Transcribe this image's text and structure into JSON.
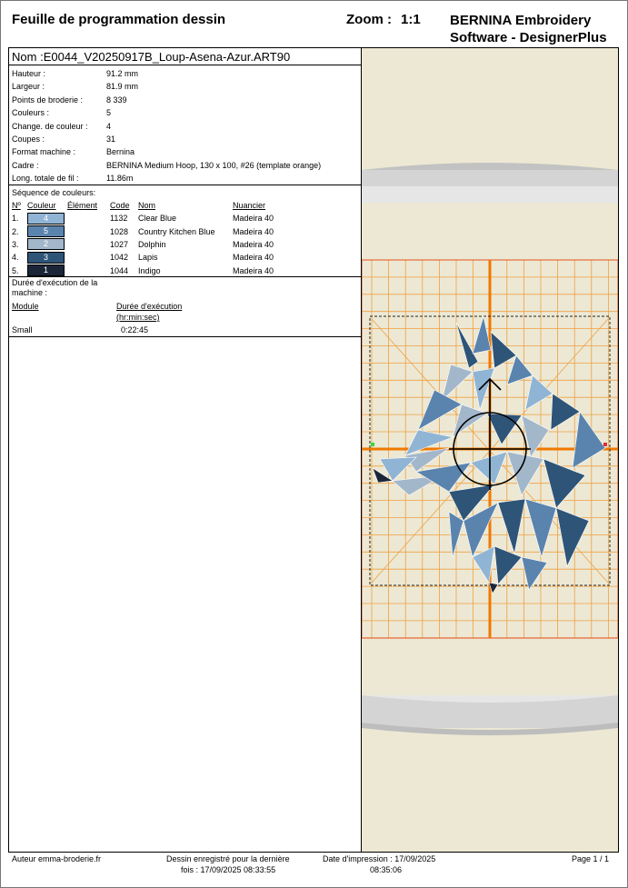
{
  "header": {
    "title": "Feuille de programmation dessin",
    "zoom_label": "Zoom :",
    "zoom_value": "1:1",
    "brand_line1": "BERNINA Embroidery",
    "brand_line2": "Software - DesignerPlus"
  },
  "design": {
    "name_label": "Nom",
    "name_value": ":E0044_V20250917B_Loup-Asena-Azur.ART90"
  },
  "info": [
    {
      "label": "Hauteur :",
      "value": "91.2 mm"
    },
    {
      "label": "Largeur :",
      "value": "81.9 mm"
    },
    {
      "label": "Points de broderie :",
      "value": "8 339"
    },
    {
      "label": "Couleurs :",
      "value": "5"
    },
    {
      "label": "Change. de couleur :",
      "value": "4"
    },
    {
      "label": "Coupes :",
      "value": "31"
    },
    {
      "label": "Format machine :",
      "value": "Bernina"
    },
    {
      "label": "Cadre :",
      "value": "BERNINA Medium Hoop, 130 x 100, #26 (template orange)"
    },
    {
      "label": "Long. totale de fil :",
      "value": "11.86m"
    }
  ],
  "sequence": {
    "title": "Séquence de couleurs:",
    "headers": {
      "no": "Nº",
      "color": "Couleur",
      "element": "Élément",
      "code": "Code",
      "name": "Nom",
      "chart": "Nuancier"
    },
    "rows": [
      {
        "no": "1.",
        "swatch": "4",
        "hex": "#90b4d4",
        "code": "1132",
        "name": "Clear Blue",
        "chart": "Madeira 40"
      },
      {
        "no": "2.",
        "swatch": "5",
        "hex": "#5a84ae",
        "code": "1028",
        "name": "Country Kitchen Blue",
        "chart": "Madeira 40"
      },
      {
        "no": "3.",
        "swatch": "2",
        "hex": "#a3b7cb",
        "code": "1027",
        "name": "Dolphin",
        "chart": "Madeira 40"
      },
      {
        "no": "4.",
        "swatch": "3",
        "hex": "#2e5478",
        "code": "1042",
        "name": "Lapis",
        "chart": "Madeira 40"
      },
      {
        "no": "5.",
        "swatch": "1",
        "hex": "#1a2638",
        "code": "1044",
        "name": "Indigo",
        "chart": "Madeira 40"
      }
    ]
  },
  "execution": {
    "title_line1": "Durée d'exécution de la",
    "title_line2": "machine :",
    "module_header": "Module",
    "duration_header_line1": "Durée d'exécution",
    "duration_header_line2": "(hr:min:sec)",
    "module": "Small",
    "duration": "0:22:45"
  },
  "footer": {
    "author": "Auteur emma-broderie.fr",
    "saved_line1": "Dessin enregistré pour la dernière",
    "saved_line2": "fois : 17/09/2025 08:33:55",
    "printed_line1": "Date d'impression : 17/09/2025",
    "printed_line2": "08:35:06",
    "page": "Page 1 / 1"
  },
  "colors": {
    "grid": "#f0a040",
    "axis": "#f07800",
    "hoop": "#d0d0d0",
    "background": "#ece8d4"
  },
  "icons": [
    "hoop-center-crosshair-icon",
    "stitch-direction-arrow-icon"
  ]
}
